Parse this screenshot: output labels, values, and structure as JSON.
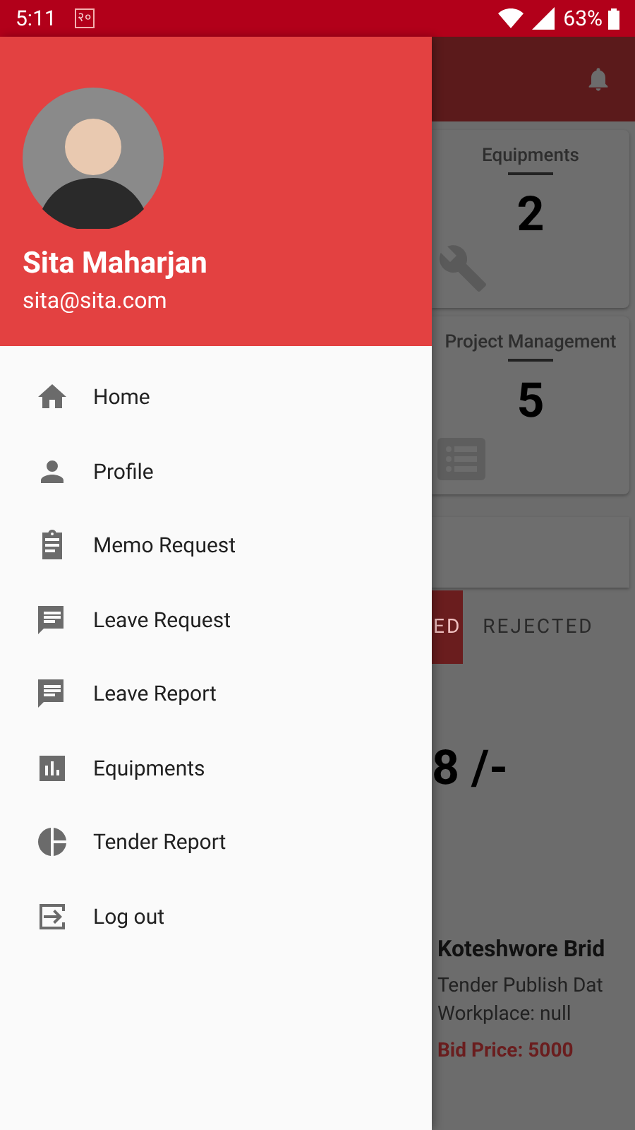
{
  "status_bar": {
    "time": "5:11",
    "notification": "२०",
    "battery": "63%"
  },
  "drawer": {
    "user_name": "Sita Maharjan",
    "email": "sita@sita.com",
    "items": [
      {
        "label": "Home",
        "kind": "home"
      },
      {
        "label": "Profile",
        "kind": "person"
      },
      {
        "label": "Memo Request",
        "kind": "clipboard"
      },
      {
        "label": "Leave Request",
        "kind": "chat"
      },
      {
        "label": "Leave Report",
        "kind": "chat"
      },
      {
        "label": "Equipments",
        "kind": "bar-chart"
      },
      {
        "label": "Tender Report",
        "kind": "pie"
      },
      {
        "label": "Log out",
        "kind": "logout"
      }
    ]
  },
  "background": {
    "cards": [
      {
        "title": "Equipments",
        "count": "2",
        "kind": "wrench"
      },
      {
        "title": "Project Management",
        "count": "5",
        "kind": "list"
      }
    ],
    "tabs": [
      {
        "label": "ED",
        "selected": true
      },
      {
        "label": "REJECTED",
        "selected": false
      }
    ],
    "amount": "8 /-",
    "tender": {
      "title": "Koteshwore Brid",
      "publish": "Tender Publish Dat",
      "workplace": "Workplace: null",
      "bid_price": "Bid Price: 5000"
    }
  }
}
